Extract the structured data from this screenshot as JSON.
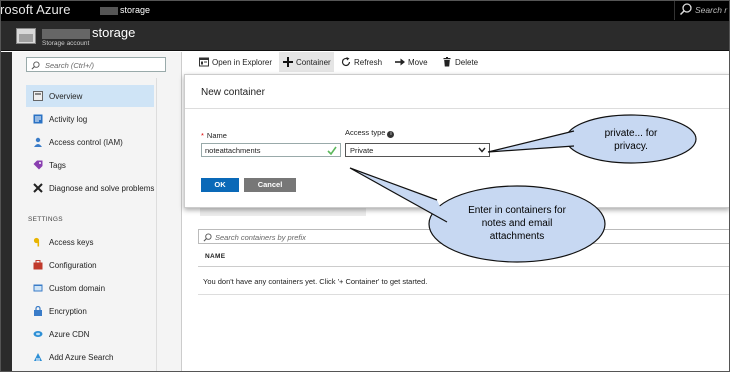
{
  "topbar": {
    "brand": "rosoft Azure",
    "account_suffix": "storage",
    "search_placeholder": "Search r"
  },
  "blade": {
    "name_suffix": "storage",
    "subtitle": "Storage account"
  },
  "leftnav": {
    "search_placeholder": "Search (Ctrl+/)",
    "items": [
      {
        "label": "Overview",
        "icon": "overview-icon"
      },
      {
        "label": "Activity log",
        "icon": "activity-log-icon"
      },
      {
        "label": "Access control (IAM)",
        "icon": "iam-icon"
      },
      {
        "label": "Tags",
        "icon": "tag-icon"
      },
      {
        "label": "Diagnose and solve problems",
        "icon": "wrench-icon"
      }
    ],
    "section_label": "SETTINGS",
    "settings_items": [
      {
        "label": "Access keys",
        "icon": "key-icon"
      },
      {
        "label": "Configuration",
        "icon": "configuration-icon"
      },
      {
        "label": "Custom domain",
        "icon": "custom-domain-icon"
      },
      {
        "label": "Encryption",
        "icon": "lock-icon"
      },
      {
        "label": "Azure CDN",
        "icon": "cdn-icon"
      },
      {
        "label": "Add Azure Search",
        "icon": "azure-search-icon"
      }
    ]
  },
  "toolbar": {
    "open_explorer": "Open in Explorer",
    "container": "Container",
    "refresh": "Refresh",
    "move": "Move",
    "delete": "Delete"
  },
  "dialog": {
    "title": "New container",
    "name_label": "Name",
    "name_value": "noteattachments",
    "access_label": "Access type",
    "access_value": "Private",
    "ok": "OK",
    "cancel": "Cancel"
  },
  "containers": {
    "search_placeholder": "Search containers by prefix",
    "column_name": "NAME",
    "empty_message": "You don't have any containers yet. Click '+ Container' to get started."
  },
  "callouts": {
    "privacy": [
      "private... for",
      "privacy."
    ],
    "enter": [
      "Enter in containers for",
      "notes and email",
      "attachments"
    ]
  },
  "colors": {
    "accent": "#0a69b8",
    "active_nav": "#cfe4f6",
    "topbar": "#000000"
  }
}
